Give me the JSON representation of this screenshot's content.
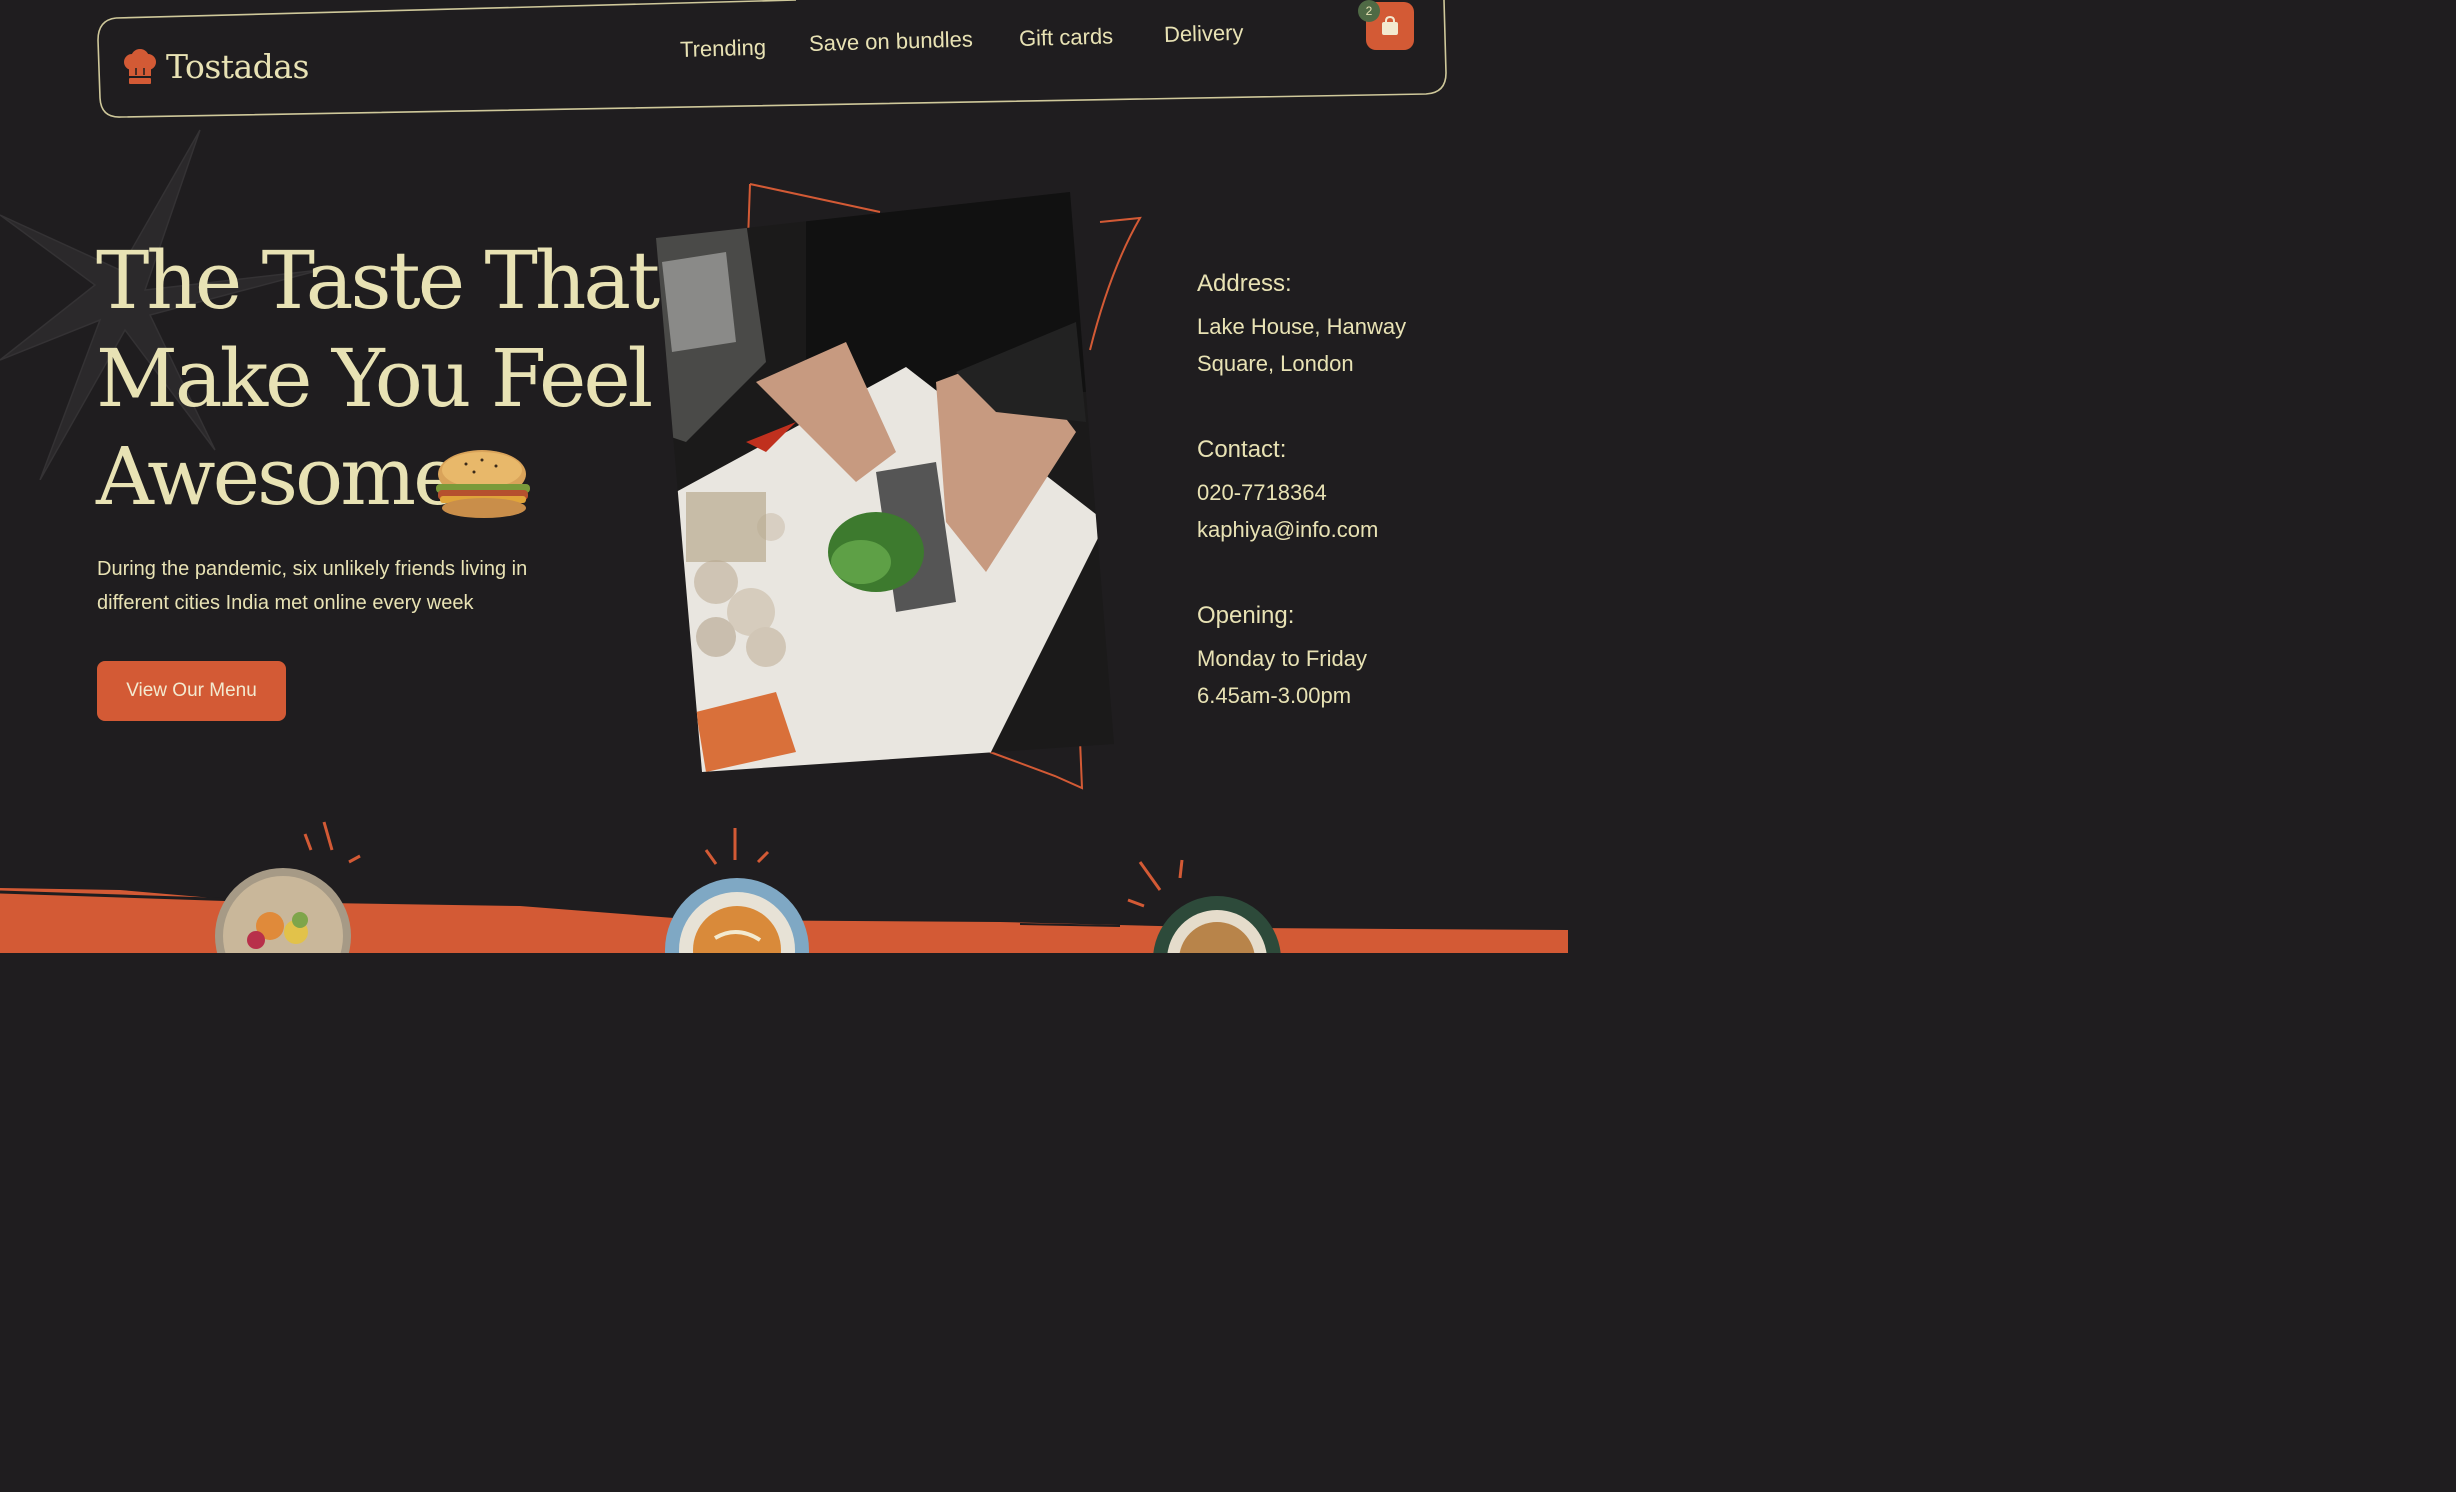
{
  "brand": {
    "name": "Tostadas",
    "logo_icon": "chef-hat-icon"
  },
  "nav": {
    "links": [
      {
        "label": "Trending"
      },
      {
        "label": "Save on bundles"
      },
      {
        "label": "Gift cards"
      },
      {
        "label": "Delivery"
      }
    ],
    "cart": {
      "icon": "shopping-bag-icon",
      "count": "2"
    }
  },
  "hero": {
    "title_lines": [
      "The Taste That",
      "Make You Feel",
      "Awesome"
    ],
    "description": "During the pandemic, six unlikely friends living in different cities India met online every week",
    "cta_label": "View Our Menu"
  },
  "info": {
    "address": {
      "label": "Address:",
      "lines": [
        "Lake House, Hanway",
        "Square, London"
      ]
    },
    "contact": {
      "label": "Contact:",
      "lines": [
        "020-7718364",
        "kaphiya@info.com"
      ]
    },
    "opening": {
      "label": "Opening:",
      "lines": [
        "Monday to Friday",
        "6.45am-3.00pm"
      ]
    }
  },
  "colors": {
    "background": "#1f1d1f",
    "accent": "#d35a35",
    "cream": "#e8e2b4",
    "badge": "#4f6a45"
  }
}
